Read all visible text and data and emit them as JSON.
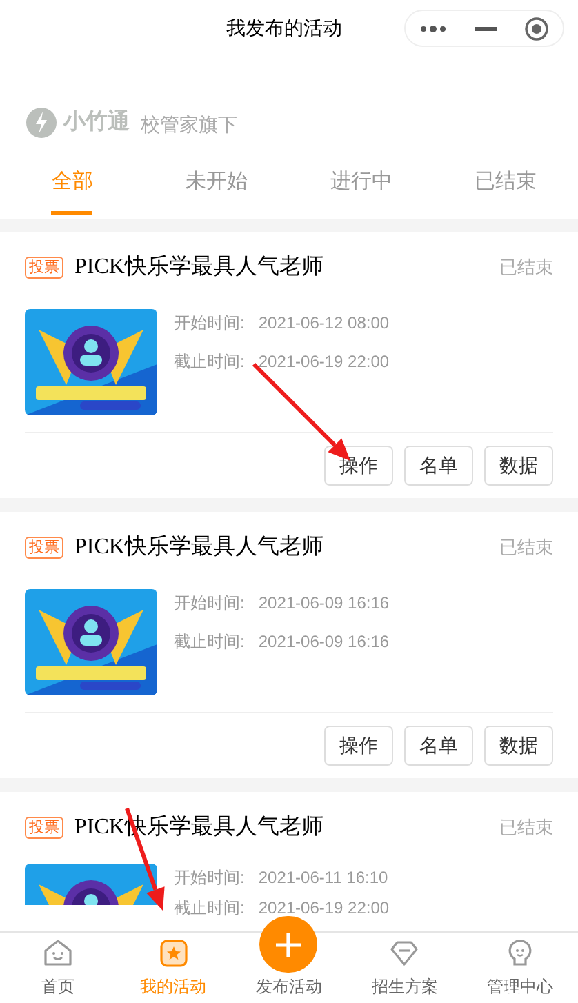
{
  "window": {
    "title": "我发布的活动"
  },
  "brand": {
    "name": "小竹通",
    "tagline": "校管家旗下"
  },
  "tabs": [
    {
      "label": "全部",
      "selected": true
    },
    {
      "label": "未开始",
      "selected": false
    },
    {
      "label": "进行中",
      "selected": false
    },
    {
      "label": "已结束",
      "selected": false
    }
  ],
  "activities": [
    {
      "tag": "投票",
      "title": "PICK快乐学最具人气老师",
      "status": "已结束",
      "start_label": "开始时间:",
      "start": "2021-06-12 08:00",
      "end_label": "截止时间:",
      "end": "2021-06-19 22:00",
      "actions": [
        "操作",
        "名单",
        "数据"
      ],
      "arrow": true
    },
    {
      "tag": "投票",
      "title": "PICK快乐学最具人气老师",
      "status": "已结束",
      "start_label": "开始时间:",
      "start": "2021-06-09 16:16",
      "end_label": "截止时间:",
      "end": "2021-06-09 16:16",
      "actions": [
        "操作",
        "名单",
        "数据"
      ],
      "arrow": false
    },
    {
      "tag": "投票",
      "title": "PICK快乐学最具人气老师",
      "status": "已结束",
      "start_label": "开始时间:",
      "start": "2021-06-11 16:10",
      "end_label": "截止时间:",
      "end": "2021-06-19 22:00",
      "arrow": true
    }
  ],
  "nav": [
    {
      "label": "首页",
      "kind": "home",
      "selected": false
    },
    {
      "label": "我的活动",
      "kind": "star",
      "selected": true
    },
    {
      "label": "发布活动",
      "kind": "plus",
      "selected": false
    },
    {
      "label": "招生方案",
      "kind": "gem",
      "selected": false
    },
    {
      "label": "管理中心",
      "kind": "bulb",
      "selected": false
    }
  ]
}
